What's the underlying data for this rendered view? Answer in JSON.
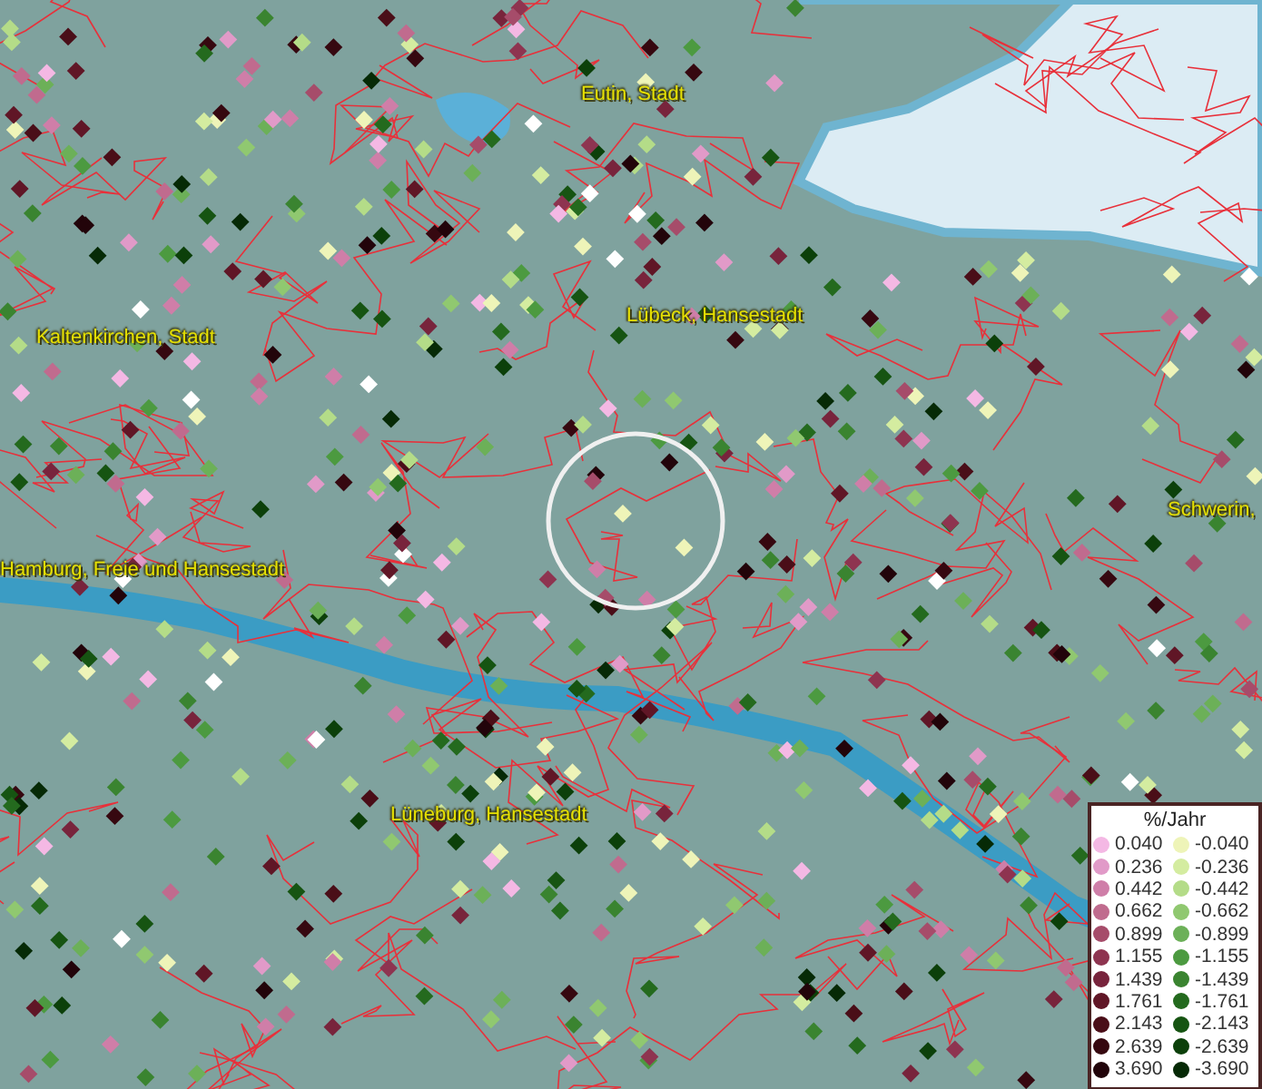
{
  "map": {
    "places": [
      {
        "name": "Eutin, Stadt"
      },
      {
        "name": "Kaltenkirchen, Stadt"
      },
      {
        "name": "Lübeck, Hansestadt"
      },
      {
        "name": "Schwerin,"
      },
      {
        "name": "Hamburg, Freie und Hansestadt"
      },
      {
        "name": "Lüneburg, Hansestadt"
      }
    ]
  },
  "legend": {
    "title": "%/Jahr",
    "positive": [
      {
        "label": "0.040",
        "color": "#f4b8e4"
      },
      {
        "label": "0.236",
        "color": "#e19ac8"
      },
      {
        "label": "0.442",
        "color": "#cf7ea8"
      },
      {
        "label": "0.662",
        "color": "#c06b8e"
      },
      {
        "label": "0.899",
        "color": "#a64c6a"
      },
      {
        "label": "1.155",
        "color": "#8e3450"
      },
      {
        "label": "1.439",
        "color": "#78243c"
      },
      {
        "label": "1.761",
        "color": "#601626"
      },
      {
        "label": "2.143",
        "color": "#4a0e18"
      },
      {
        "label": "2.639",
        "color": "#360810"
      },
      {
        "label": "3.690",
        "color": "#22040a"
      }
    ],
    "negative": [
      {
        "label": "-0.040",
        "color": "#eef4b8"
      },
      {
        "label": "-0.236",
        "color": "#d4eca0"
      },
      {
        "label": "-0.442",
        "color": "#b4dc88"
      },
      {
        "label": "-0.662",
        "color": "#90c870"
      },
      {
        "label": "-0.899",
        "color": "#6cb058"
      },
      {
        "label": "-1.155",
        "color": "#4c9a40"
      },
      {
        "label": "-1.439",
        "color": "#3a8430"
      },
      {
        "label": "-1.761",
        "color": "#246a1e"
      },
      {
        "label": "-2.143",
        "color": "#165412"
      },
      {
        "label": "-2.639",
        "color": "#0c400a"
      },
      {
        "label": "-3.690",
        "color": "#062a06"
      }
    ]
  }
}
